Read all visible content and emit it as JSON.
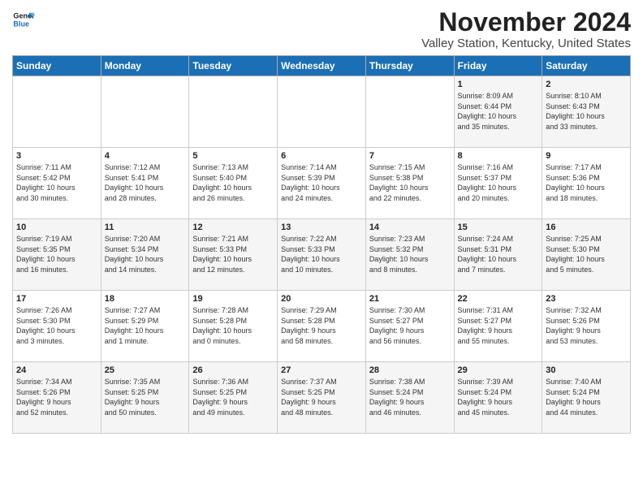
{
  "logo": {
    "line1": "General",
    "line2": "Blue"
  },
  "title": "November 2024",
  "location": "Valley Station, Kentucky, United States",
  "weekdays": [
    "Sunday",
    "Monday",
    "Tuesday",
    "Wednesday",
    "Thursday",
    "Friday",
    "Saturday"
  ],
  "weeks": [
    [
      {
        "day": "",
        "info": ""
      },
      {
        "day": "",
        "info": ""
      },
      {
        "day": "",
        "info": ""
      },
      {
        "day": "",
        "info": ""
      },
      {
        "day": "",
        "info": ""
      },
      {
        "day": "1",
        "info": "Sunrise: 8:09 AM\nSunset: 6:44 PM\nDaylight: 10 hours\nand 35 minutes."
      },
      {
        "day": "2",
        "info": "Sunrise: 8:10 AM\nSunset: 6:43 PM\nDaylight: 10 hours\nand 33 minutes."
      }
    ],
    [
      {
        "day": "3",
        "info": "Sunrise: 7:11 AM\nSunset: 5:42 PM\nDaylight: 10 hours\nand 30 minutes."
      },
      {
        "day": "4",
        "info": "Sunrise: 7:12 AM\nSunset: 5:41 PM\nDaylight: 10 hours\nand 28 minutes."
      },
      {
        "day": "5",
        "info": "Sunrise: 7:13 AM\nSunset: 5:40 PM\nDaylight: 10 hours\nand 26 minutes."
      },
      {
        "day": "6",
        "info": "Sunrise: 7:14 AM\nSunset: 5:39 PM\nDaylight: 10 hours\nand 24 minutes."
      },
      {
        "day": "7",
        "info": "Sunrise: 7:15 AM\nSunset: 5:38 PM\nDaylight: 10 hours\nand 22 minutes."
      },
      {
        "day": "8",
        "info": "Sunrise: 7:16 AM\nSunset: 5:37 PM\nDaylight: 10 hours\nand 20 minutes."
      },
      {
        "day": "9",
        "info": "Sunrise: 7:17 AM\nSunset: 5:36 PM\nDaylight: 10 hours\nand 18 minutes."
      }
    ],
    [
      {
        "day": "10",
        "info": "Sunrise: 7:19 AM\nSunset: 5:35 PM\nDaylight: 10 hours\nand 16 minutes."
      },
      {
        "day": "11",
        "info": "Sunrise: 7:20 AM\nSunset: 5:34 PM\nDaylight: 10 hours\nand 14 minutes."
      },
      {
        "day": "12",
        "info": "Sunrise: 7:21 AM\nSunset: 5:33 PM\nDaylight: 10 hours\nand 12 minutes."
      },
      {
        "day": "13",
        "info": "Sunrise: 7:22 AM\nSunset: 5:33 PM\nDaylight: 10 hours\nand 10 minutes."
      },
      {
        "day": "14",
        "info": "Sunrise: 7:23 AM\nSunset: 5:32 PM\nDaylight: 10 hours\nand 8 minutes."
      },
      {
        "day": "15",
        "info": "Sunrise: 7:24 AM\nSunset: 5:31 PM\nDaylight: 10 hours\nand 7 minutes."
      },
      {
        "day": "16",
        "info": "Sunrise: 7:25 AM\nSunset: 5:30 PM\nDaylight: 10 hours\nand 5 minutes."
      }
    ],
    [
      {
        "day": "17",
        "info": "Sunrise: 7:26 AM\nSunset: 5:30 PM\nDaylight: 10 hours\nand 3 minutes."
      },
      {
        "day": "18",
        "info": "Sunrise: 7:27 AM\nSunset: 5:29 PM\nDaylight: 10 hours\nand 1 minute."
      },
      {
        "day": "19",
        "info": "Sunrise: 7:28 AM\nSunset: 5:28 PM\nDaylight: 10 hours\nand 0 minutes."
      },
      {
        "day": "20",
        "info": "Sunrise: 7:29 AM\nSunset: 5:28 PM\nDaylight: 9 hours\nand 58 minutes."
      },
      {
        "day": "21",
        "info": "Sunrise: 7:30 AM\nSunset: 5:27 PM\nDaylight: 9 hours\nand 56 minutes."
      },
      {
        "day": "22",
        "info": "Sunrise: 7:31 AM\nSunset: 5:27 PM\nDaylight: 9 hours\nand 55 minutes."
      },
      {
        "day": "23",
        "info": "Sunrise: 7:32 AM\nSunset: 5:26 PM\nDaylight: 9 hours\nand 53 minutes."
      }
    ],
    [
      {
        "day": "24",
        "info": "Sunrise: 7:34 AM\nSunset: 5:26 PM\nDaylight: 9 hours\nand 52 minutes."
      },
      {
        "day": "25",
        "info": "Sunrise: 7:35 AM\nSunset: 5:25 PM\nDaylight: 9 hours\nand 50 minutes."
      },
      {
        "day": "26",
        "info": "Sunrise: 7:36 AM\nSunset: 5:25 PM\nDaylight: 9 hours\nand 49 minutes."
      },
      {
        "day": "27",
        "info": "Sunrise: 7:37 AM\nSunset: 5:25 PM\nDaylight: 9 hours\nand 48 minutes."
      },
      {
        "day": "28",
        "info": "Sunrise: 7:38 AM\nSunset: 5:24 PM\nDaylight: 9 hours\nand 46 minutes."
      },
      {
        "day": "29",
        "info": "Sunrise: 7:39 AM\nSunset: 5:24 PM\nDaylight: 9 hours\nand 45 minutes."
      },
      {
        "day": "30",
        "info": "Sunrise: 7:40 AM\nSunset: 5:24 PM\nDaylight: 9 hours\nand 44 minutes."
      }
    ]
  ]
}
